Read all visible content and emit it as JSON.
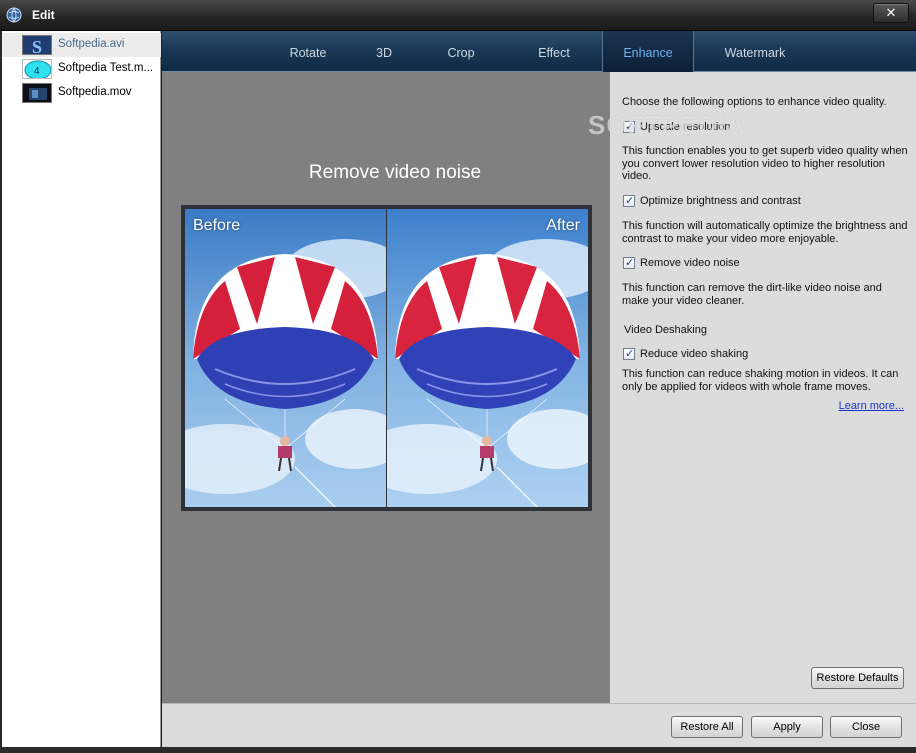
{
  "window": {
    "title": "Edit",
    "close_glyph": "✕"
  },
  "files": [
    {
      "name": "Softpedia.avi",
      "thumb_icon": "softpedia-logo-thumb"
    },
    {
      "name": "Softpedia Test.m...",
      "thumb_icon": "cyan-badge-thumb"
    },
    {
      "name": "Softpedia.mov",
      "thumb_icon": "dark-video-thumb"
    }
  ],
  "tabs": [
    "Rotate",
    "3D",
    "Crop",
    "Effect",
    "Enhance",
    "Watermark"
  ],
  "active_tab": "Enhance",
  "preview": {
    "title": "Remove video noise",
    "before_label": "Before",
    "after_label": "After"
  },
  "enhance": {
    "intro": "Choose the following options to enhance video quality.",
    "options": [
      {
        "label": "Upscale resolution",
        "checked": true,
        "description": "This function enables you to get superb video quality when you convert lower resolution video to higher resolution video."
      },
      {
        "label": "Optimize brightness and contrast",
        "checked": true,
        "description": "This function will automatically optimize the brightness and contrast to make your video more enjoyable."
      },
      {
        "label": "Remove video noise",
        "checked": true,
        "description": "This function can remove the dirt-like video noise and make your video cleaner."
      }
    ],
    "deshake_section": "Video Deshaking",
    "deshake": {
      "label": "Reduce video shaking",
      "checked": true,
      "description": "This function can reduce shaking motion in videos. It can only be applied for videos with whole frame moves."
    },
    "learn_more": "Learn more...",
    "restore_defaults": "Restore Defaults",
    "watermark_text": "SOFTPEDIA"
  },
  "buttons": {
    "restore_all": "Restore All",
    "apply": "Apply",
    "close": "Close"
  },
  "check_glyph": "✓",
  "colors": {
    "tab_bar": "#1b3856",
    "active_tab_text": "#6fb2ef",
    "link": "#1a35c8",
    "preview_bg": "#808080"
  }
}
